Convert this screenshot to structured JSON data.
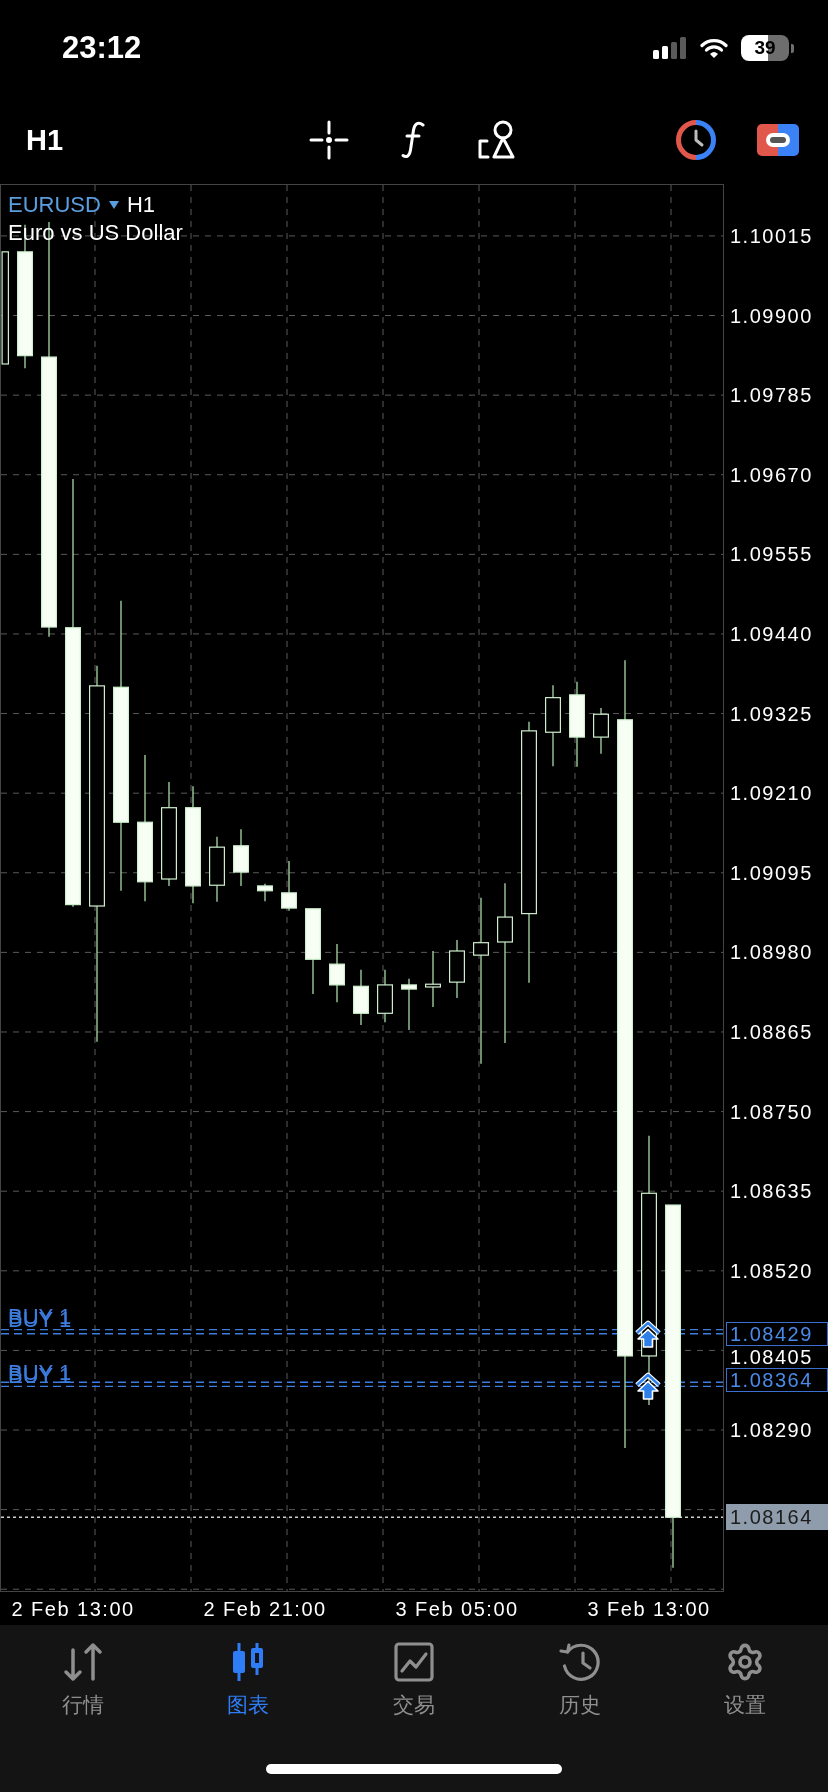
{
  "status_bar": {
    "time": "23:12",
    "battery": "39"
  },
  "toolbar": {
    "timeframe": "H1"
  },
  "chart": {
    "symbol": "EURUSD",
    "timeframe": "H1",
    "description": "Euro vs US Dollar",
    "orders": [
      {
        "label": "BUY 1",
        "price": "1.08429"
      },
      {
        "label": "BUY 1",
        "price": "1.08364"
      }
    ],
    "current_price": "1.08164",
    "chart_data": {
      "type": "candlestick",
      "grid": true,
      "categories": [
        null,
        null,
        null,
        "2 Feb 13:00",
        null,
        null,
        null,
        null,
        null,
        null,
        null,
        "2 Feb 21:00",
        null,
        null,
        null,
        null,
        null,
        null,
        null,
        "3 Feb 05:00",
        null,
        null,
        null,
        null,
        null,
        null,
        null,
        "3 Feb 13:00",
        null
      ],
      "ohlc": [
        [
          1.0983,
          1.09992,
          1.0983,
          1.09992
        ],
        [
          1.09992,
          1.10031,
          1.09824,
          1.09842
        ],
        [
          1.0984,
          1.10035,
          1.09436,
          1.0945
        ],
        [
          1.09449,
          1.09664,
          1.09046,
          1.09049
        ],
        [
          1.09047,
          1.09394,
          1.08851,
          1.09365
        ],
        [
          1.09363,
          1.09488,
          1.09069,
          1.09168
        ],
        [
          1.09168,
          1.09265,
          1.09054,
          1.09082
        ],
        [
          1.09086,
          1.09226,
          1.09076,
          1.09189
        ],
        [
          1.09189,
          1.0922,
          1.09051,
          1.09076
        ],
        [
          1.09077,
          1.09147,
          1.09053,
          1.09132
        ],
        [
          1.09134,
          1.09158,
          1.09076,
          1.09096
        ],
        [
          1.09076,
          1.09079,
          1.09054,
          1.09069
        ],
        [
          1.09066,
          1.09112,
          1.0904,
          1.09044
        ],
        [
          1.09043,
          1.09043,
          1.0892,
          1.0897
        ],
        [
          1.08963,
          1.08992,
          1.08908,
          1.08933
        ],
        [
          1.08931,
          1.08955,
          1.08875,
          1.08892
        ],
        [
          1.08892,
          1.08955,
          1.08879,
          1.08933
        ],
        [
          1.08933,
          1.08942,
          1.08868,
          1.08927
        ],
        [
          1.0893,
          1.08982,
          1.08901,
          1.08934
        ],
        [
          1.08937,
          1.08998,
          1.08914,
          1.08982
        ],
        [
          1.08976,
          1.09059,
          1.08819,
          1.08994
        ],
        [
          1.08995,
          1.0908,
          1.08849,
          1.09031
        ],
        [
          1.09036,
          1.09313,
          1.08936,
          1.093
        ],
        [
          1.09298,
          1.09366,
          1.09249,
          1.09348
        ],
        [
          1.09352,
          1.09371,
          1.09248,
          1.09291
        ],
        [
          1.09291,
          1.09333,
          1.09267,
          1.09324
        ],
        [
          1.09316,
          1.09402,
          1.08264,
          1.08397
        ],
        [
          1.08397,
          1.08715,
          1.08326,
          1.08632
        ],
        [
          1.08615,
          1.08615,
          1.08091,
          1.08164
        ]
      ],
      "ylim": [
        1.08056,
        1.1009
      ],
      "yticks": [
        {
          "value": 1.10015,
          "label": "1.10015"
        },
        {
          "value": 1.099,
          "label": "1.09900"
        },
        {
          "value": 1.09785,
          "label": "1.09785"
        },
        {
          "value": 1.0967,
          "label": "1.09670"
        },
        {
          "value": 1.09555,
          "label": "1.09555"
        },
        {
          "value": 1.0944,
          "label": "1.09440"
        },
        {
          "value": 1.09325,
          "label": "1.09325"
        },
        {
          "value": 1.0921,
          "label": "1.09210"
        },
        {
          "value": 1.09095,
          "label": "1.09095"
        },
        {
          "value": 1.0898,
          "label": "1.08980"
        },
        {
          "value": 1.08865,
          "label": "1.08865"
        },
        {
          "value": 1.0875,
          "label": "1.08750"
        },
        {
          "value": 1.08635,
          "label": "1.08635"
        },
        {
          "value": 1.0852,
          "label": "1.08520"
        },
        {
          "value": 1.08405,
          "label": "1.08405"
        },
        {
          "value": 1.0829,
          "label": "1.08290"
        }
      ],
      "ref_lines": [
        {
          "axis": "y",
          "value": 1.08435,
          "color": "#3d7de0"
        },
        {
          "axis": "y",
          "value": 1.08429,
          "color": "#3d7de0"
        },
        {
          "axis": "y",
          "value": 1.08359,
          "color": "#3d7de0"
        },
        {
          "axis": "y",
          "value": 1.08353,
          "color": "#3d7de0"
        },
        {
          "axis": "y",
          "value": 1.08164,
          "color": "#d0d0d0"
        }
      ]
    }
  },
  "tab_bar": [
    {
      "label": "行情",
      "selected": false
    },
    {
      "label": "图表",
      "selected": true
    },
    {
      "label": "交易",
      "selected": false
    },
    {
      "label": "历史",
      "selected": false
    },
    {
      "label": "设置",
      "selected": false
    }
  ]
}
